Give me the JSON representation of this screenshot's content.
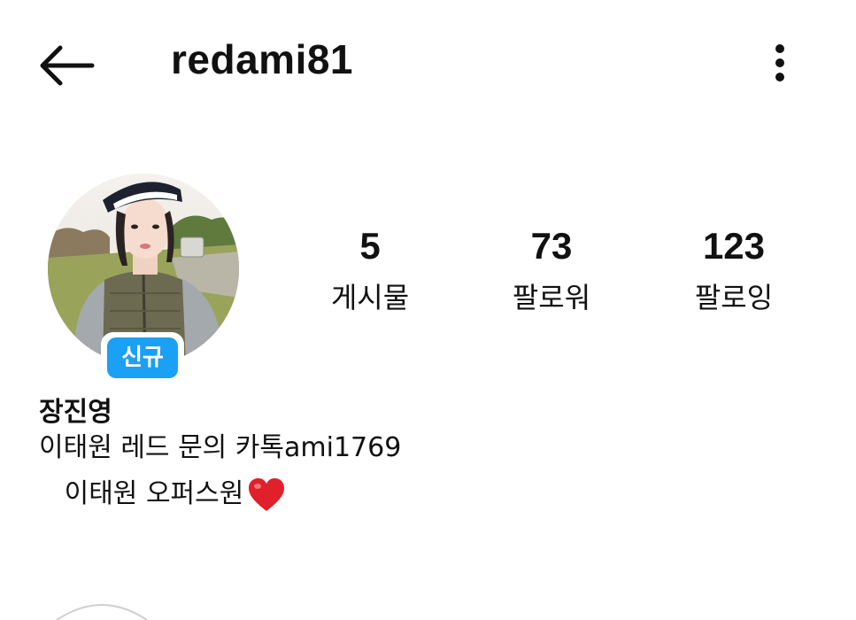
{
  "header": {
    "username": "redami81"
  },
  "profile": {
    "badge": "신규",
    "display_name": "장진영",
    "bio_line_1": "이태원 레드 문의 카톡ami1769",
    "bio_line_2": "   이태원 오퍼스원"
  },
  "stats": [
    {
      "count": "5",
      "label": "게시물"
    },
    {
      "count": "73",
      "label": "팔로워"
    },
    {
      "count": "123",
      "label": "팔로잉"
    }
  ],
  "icons": {
    "back": "arrow-left-icon",
    "more": "more-vertical-icon",
    "heart": "red-heart-emoji"
  },
  "colors": {
    "badge": "#1aa0f5",
    "heart": "#e0202a",
    "text": "#111111"
  }
}
